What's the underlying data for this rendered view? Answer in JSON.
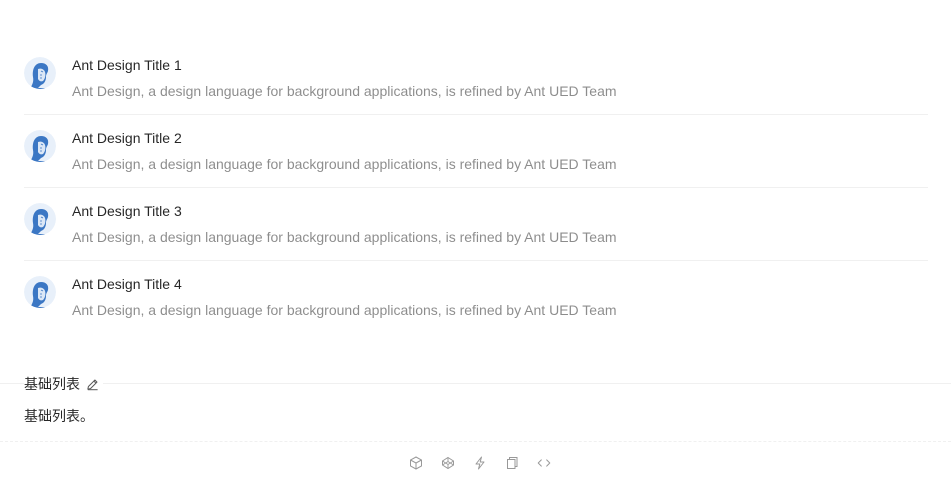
{
  "list": {
    "items": [
      {
        "title": "Ant Design Title 1",
        "description": "Ant Design, a design language for background applications, is refined by Ant UED Team"
      },
      {
        "title": "Ant Design Title 2",
        "description": "Ant Design, a design language for background applications, is refined by Ant UED Team"
      },
      {
        "title": "Ant Design Title 3",
        "description": "Ant Design, a design language for background applications, is refined by Ant UED Team"
      },
      {
        "title": "Ant Design Title 4",
        "description": "Ant Design, a design language for background applications, is refined by Ant UED Team"
      }
    ]
  },
  "demo_meta": {
    "title": "基础列表",
    "description": "基础列表。"
  },
  "actions": {
    "icons": [
      "codesandbox-icon",
      "codepen-icon",
      "stackblitz-icon",
      "copy-icon",
      "expand-code-icon"
    ]
  },
  "colors": {
    "avatar_blue": "#3b77c4",
    "divider": "#f0f0f0",
    "secondary_text": "rgba(0,0,0,0.45)",
    "icon_gray": "#999999"
  }
}
